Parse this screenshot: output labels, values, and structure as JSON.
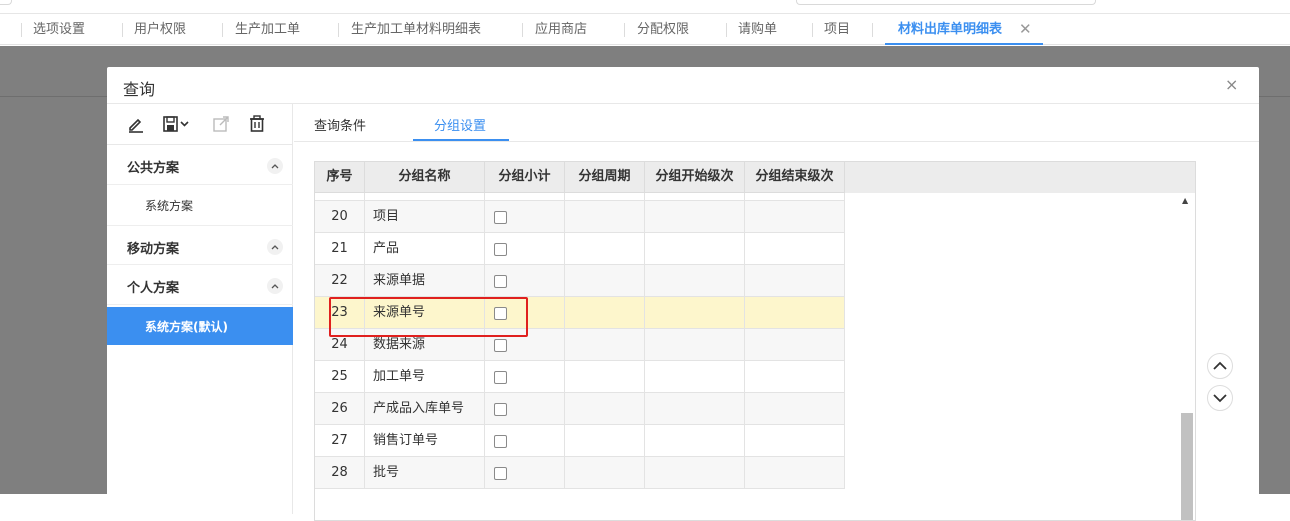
{
  "tabs": [
    {
      "label": "选项设置"
    },
    {
      "label": "用户权限"
    },
    {
      "label": "生产加工单"
    },
    {
      "label": "生产加工单材料明细表"
    },
    {
      "label": "应用商店"
    },
    {
      "label": "分配权限"
    },
    {
      "label": "请购单"
    },
    {
      "label": "项目"
    },
    {
      "label": "材料出库单明细表",
      "active": true
    }
  ],
  "dialog": {
    "title": "查询",
    "close_glyph": "×"
  },
  "sidebar": {
    "tools": [
      "edit-icon",
      "save-icon",
      "export-icon",
      "delete-icon"
    ],
    "groups": [
      {
        "title": "公共方案",
        "items": [
          "系统方案"
        ]
      },
      {
        "title": "移动方案",
        "items": []
      },
      {
        "title": "个人方案",
        "items": [
          "系统方案(默认)"
        ]
      }
    ],
    "active_item": "系统方案(默认)"
  },
  "main": {
    "tabs": [
      {
        "label": "查询条件"
      },
      {
        "label": "分组设置",
        "active": true
      }
    ]
  },
  "grid": {
    "columns": [
      "序号",
      "分组名称",
      "分组小计",
      "分组周期",
      "分组开始级次",
      "分组结束级次"
    ],
    "rows": [
      {
        "no": "20",
        "name": "项目",
        "checked": false
      },
      {
        "no": "21",
        "name": "产品",
        "checked": false
      },
      {
        "no": "22",
        "name": "来源单据",
        "checked": false
      },
      {
        "no": "23",
        "name": "来源单号",
        "checked": false,
        "highlighted": true
      },
      {
        "no": "24",
        "name": "数据来源",
        "checked": false
      },
      {
        "no": "25",
        "name": "加工单号",
        "checked": false
      },
      {
        "no": "26",
        "name": "产成品入库单号",
        "checked": false
      },
      {
        "no": "27",
        "name": "销售订单号",
        "checked": false
      },
      {
        "no": "28",
        "name": "批号",
        "checked": false
      }
    ]
  },
  "colors": {
    "accent": "#3b8ff0",
    "highlight_row": "#fdf6cc",
    "annotation_box": "#e0201e"
  }
}
